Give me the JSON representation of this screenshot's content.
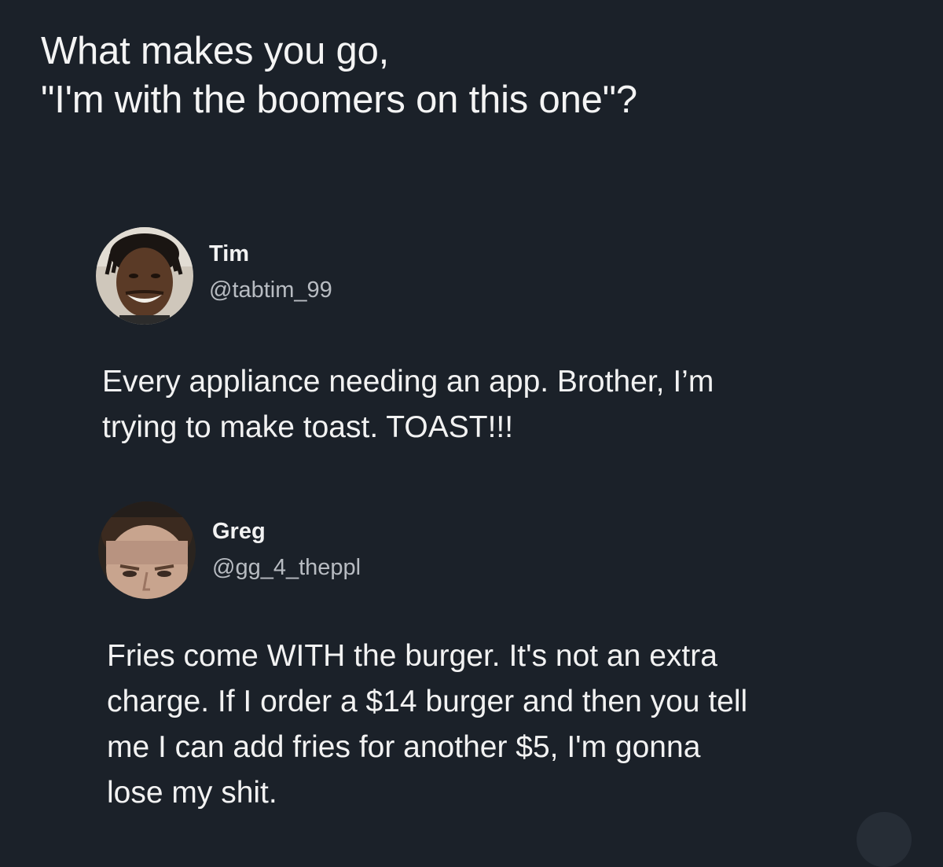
{
  "post": {
    "question_line1": "What makes you go,",
    "question_line2": "\"I'm with the boomers on this one\"?"
  },
  "replies": [
    {
      "name": "Tim",
      "handle": "@tabtim_99",
      "avatar_icon": "avatar-photo-icon",
      "text_lines": [
        "Every appliance needing an app. Brother, I’m",
        "trying to make toast. TOAST!!!"
      ]
    },
    {
      "name": "Greg",
      "handle": "@gg_4_theppl",
      "avatar_icon": "avatar-photo-icon",
      "text_lines": [
        "Fries come WITH the burger. It's not an extra",
        "charge. If I order a $14 burger and then you tell",
        "me I can add fries for another $5, I'm gonna",
        "lose my shit."
      ]
    }
  ],
  "colors": {
    "background": "#1b2129",
    "text": "#f2f2f2",
    "handle": "#b8bcc2"
  }
}
